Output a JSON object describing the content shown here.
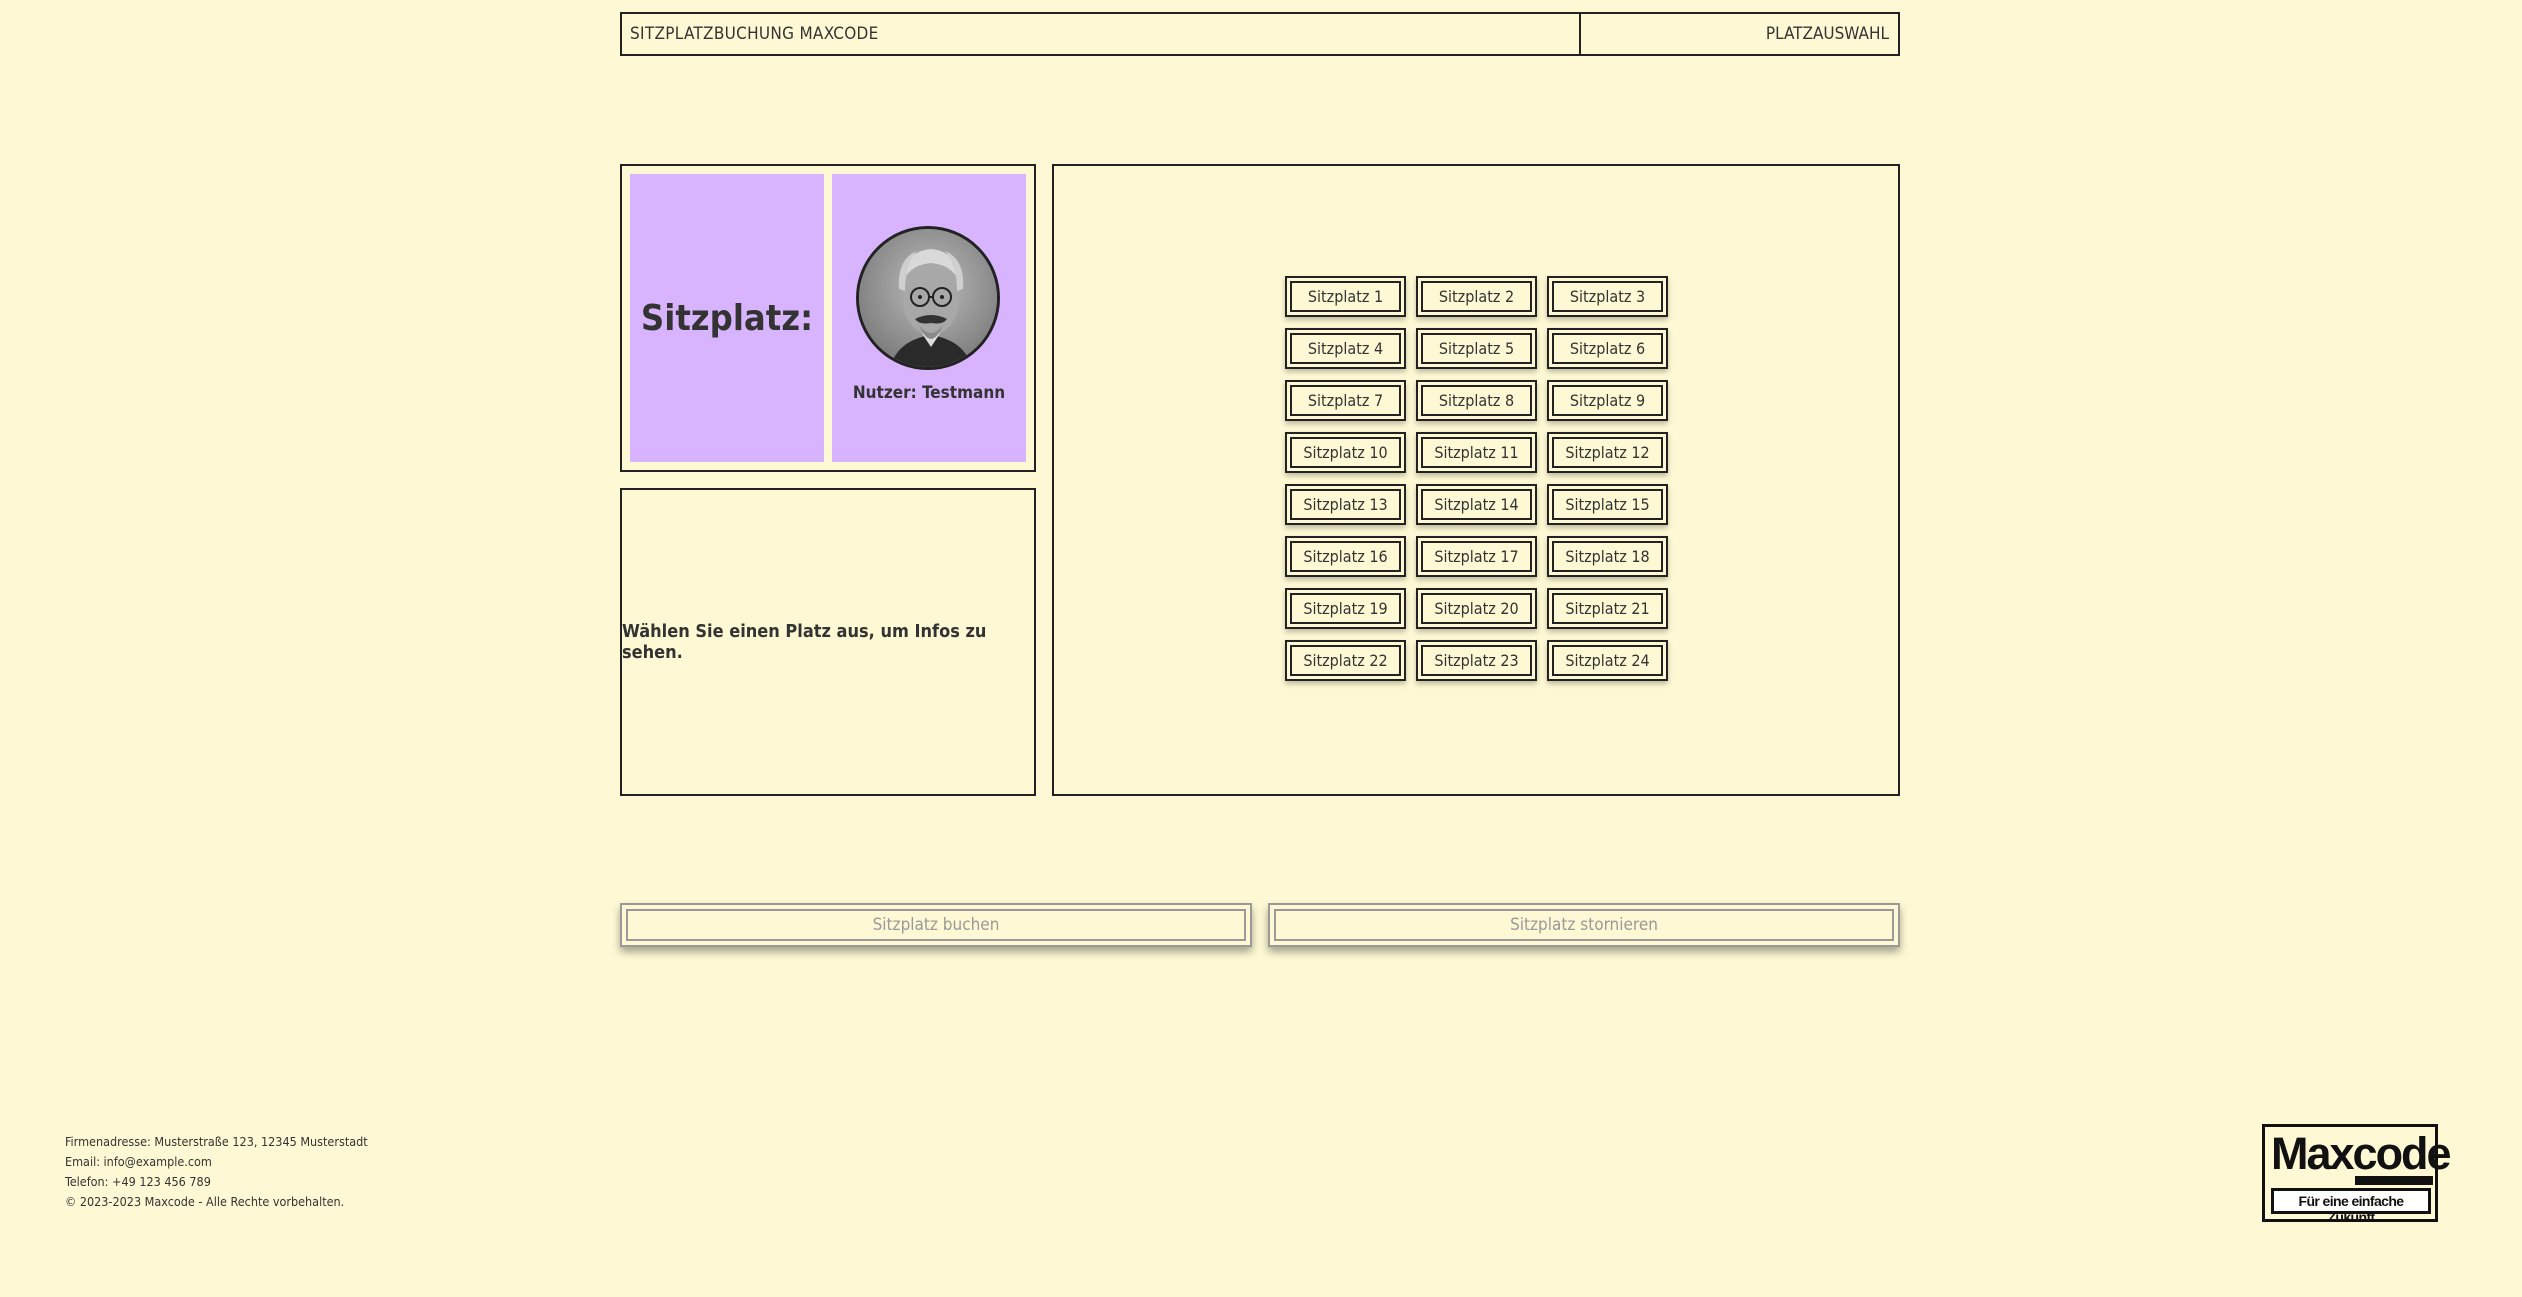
{
  "header": {
    "title": "SITZPLATZBUCHUNG MAXCODE",
    "nav": "PLATZAUSWAHL"
  },
  "user_panel": {
    "seat_label": "Sitzplatz:",
    "user_name": "Nutzer: Testmann",
    "avatar_icon": "user-portrait-icon"
  },
  "info_panel": {
    "message": "Wählen Sie einen Platz aus, um Infos zu sehen."
  },
  "seats": [
    "Sitzplatz 1",
    "Sitzplatz 2",
    "Sitzplatz 3",
    "Sitzplatz 4",
    "Sitzplatz 5",
    "Sitzplatz 6",
    "Sitzplatz 7",
    "Sitzplatz 8",
    "Sitzplatz 9",
    "Sitzplatz 10",
    "Sitzplatz 11",
    "Sitzplatz 12",
    "Sitzplatz 13",
    "Sitzplatz 14",
    "Sitzplatz 15",
    "Sitzplatz 16",
    "Sitzplatz 17",
    "Sitzplatz 18",
    "Sitzplatz 19",
    "Sitzplatz 20",
    "Sitzplatz 21",
    "Sitzplatz 22",
    "Sitzplatz 23",
    "Sitzplatz 24"
  ],
  "actions": {
    "book_label": "Sitzplatz buchen",
    "cancel_label": "Sitzplatz stornieren"
  },
  "footer": {
    "address": "Firmenadresse: Musterstraße 123, 12345 Musterstadt",
    "email": "Email: info@example.com",
    "phone": "Telefon: +49 123 456 789",
    "copyright": "© 2023-2023 Maxcode - Alle Rechte vorbehalten."
  },
  "logo": {
    "name": "Maxcode",
    "tagline": "Für eine einfache Zukunft"
  },
  "colors": {
    "background": "#fef9d4",
    "accent_tile": "#d8b4fe",
    "border": "#222222",
    "disabled_text": "#999999"
  }
}
